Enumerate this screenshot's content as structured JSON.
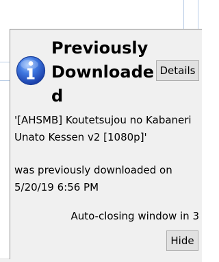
{
  "dialog": {
    "title": "Previously Downloaded",
    "icon": "info-icon",
    "details_label": "Details",
    "message_name": "'[AHSMB] Koutetsujou no Kabaneri Unato Kessen v2 [1080p]'",
    "message_tail": "was previously downloaded on 5/20/19 6:56 PM",
    "autoclose_text": "Auto-closing window in 3",
    "hide_label": "Hide"
  },
  "colors": {
    "dialog_bg": "#f0f0f0",
    "button_bg": "#e1e1e1",
    "icon_blue": "#1a50c8"
  }
}
